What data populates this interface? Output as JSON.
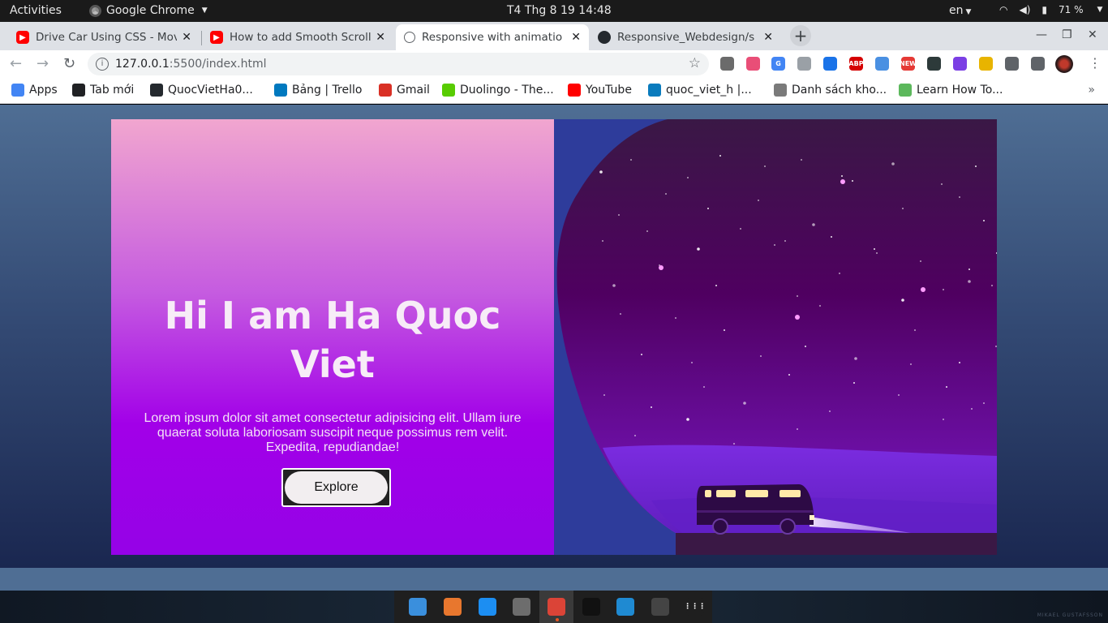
{
  "topbar": {
    "activities": "Activities",
    "app_name": "Google Chrome",
    "clock": "T4 Thg 8 19  14:48",
    "language": "en",
    "battery": "71 %"
  },
  "tabs": [
    {
      "title": "Drive Car Using CSS - Movi",
      "favicon": "youtube-icon"
    },
    {
      "title": "How to add Smooth Scroll",
      "favicon": "youtube-icon"
    },
    {
      "title": "Responsive with animatio",
      "favicon": "globe-icon",
      "active": true
    },
    {
      "title": "Responsive_Webdesign/s",
      "favicon": "github-icon"
    }
  ],
  "toolbar": {
    "url_host": "127.0.0.1",
    "url_path": ":5500/index.html"
  },
  "extensions": [
    {
      "name": "ext-ruler",
      "color": "#6b6b6b",
      "label": ""
    },
    {
      "name": "ext-colorpicker",
      "color": "#e94e77",
      "label": ""
    },
    {
      "name": "ext-translate",
      "color": "#4285f4",
      "label": "G"
    },
    {
      "name": "ext-react-devtools",
      "color": "#9aa0a6",
      "label": ""
    },
    {
      "name": "ext-drop",
      "color": "#1a73e8",
      "label": ""
    },
    {
      "name": "ext-adblock",
      "color": "#d50000",
      "label": "ABP"
    },
    {
      "name": "ext-speed",
      "color": "#4a90e2",
      "label": ""
    },
    {
      "name": "ext-new",
      "color": "#e53935",
      "label": "NEW"
    },
    {
      "name": "ext-cursor",
      "color": "#2d3a3a",
      "label": ""
    },
    {
      "name": "ext-infinity",
      "color": "#7b3fe4",
      "label": ""
    },
    {
      "name": "ext-folder",
      "color": "#e8b400",
      "label": ""
    },
    {
      "name": "ext-puzzle",
      "color": "#5f6368",
      "label": ""
    },
    {
      "name": "ext-playlist",
      "color": "#5f6368",
      "label": ""
    }
  ],
  "bookmarks": [
    {
      "label": "Apps",
      "icon": "apps-grid-icon",
      "color": "#4285f4"
    },
    {
      "label": "Tab mới",
      "icon": "newtab-icon",
      "color": "#202124"
    },
    {
      "label": "QuocVietHa0...",
      "icon": "github-icon",
      "color": "#24292e"
    },
    {
      "label": "Bảng | Trello",
      "icon": "trello-icon",
      "color": "#0079bf"
    },
    {
      "label": "Gmail",
      "icon": "gmail-icon",
      "color": "#d93025"
    },
    {
      "label": "Duolingo - The...",
      "icon": "duolingo-icon",
      "color": "#58cc02"
    },
    {
      "label": "YouTube",
      "icon": "youtube-icon",
      "color": "#ff0000"
    },
    {
      "label": "quoc_viet_h |...",
      "icon": "freecodecamp-icon",
      "color": "#0a7bbd"
    },
    {
      "label": "Danh sách kho...",
      "icon": "feather-icon",
      "color": "#7a7a7a"
    },
    {
      "label": "Learn How To...",
      "icon": "leaf-icon",
      "color": "#5cb85c"
    }
  ],
  "page": {
    "heading": "Hi I am Ha Quoc Viet",
    "paragraph": "Lorem ipsum dolor sit amet consectetur adipisicing elit. Ullam iure quaerat soluta laboriosam suscipit neque possimus rem velit. Expedita, repudiandae!",
    "button": "Explore"
  },
  "dock": [
    {
      "name": "finder-icon",
      "color": "#3a8fdd"
    },
    {
      "name": "presentation-icon",
      "color": "#e8772e"
    },
    {
      "name": "appstore-icon",
      "color": "#1c8ef2"
    },
    {
      "name": "settings-icon",
      "color": "#6d6d6d"
    },
    {
      "name": "chrome-icon",
      "color": "#db4437",
      "active": true
    },
    {
      "name": "terminal-icon",
      "color": "#111111"
    },
    {
      "name": "vscode-icon",
      "color": "#1f8ad2"
    },
    {
      "name": "calculator-icon",
      "color": "#444444"
    },
    {
      "name": "show-apps-icon",
      "color": "#1f1f1f"
    }
  ],
  "watermark": "MIKAEL GUSTAFSSON"
}
